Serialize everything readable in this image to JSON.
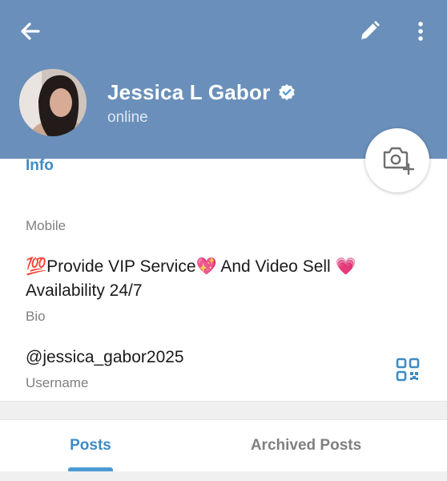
{
  "profile": {
    "name": "Jessica L Gabor",
    "status": "online"
  },
  "info": {
    "section_title": "Info",
    "mobile_label": "Mobile",
    "bio_line1": "💯Provide VIP Service💖 And Video Sell 💗",
    "bio_line2": "Availability 24/7",
    "bio_label": "Bio",
    "username_value": "@jessica_gabor2025",
    "username_label": "Username"
  },
  "tabs": [
    {
      "label": "Posts"
    },
    {
      "label": "Archived Posts"
    }
  ],
  "icons": {
    "back": "arrow-left-icon",
    "edit": "pencil-icon",
    "more": "vertical-dots-icon",
    "verified": "verified-check-icon",
    "camera": "camera-add-icon",
    "qr": "qr-code-icon"
  },
  "colors": {
    "header_bg": "#6a8fba",
    "accent": "#3d8bc4",
    "verified": "#4a9ad4"
  }
}
